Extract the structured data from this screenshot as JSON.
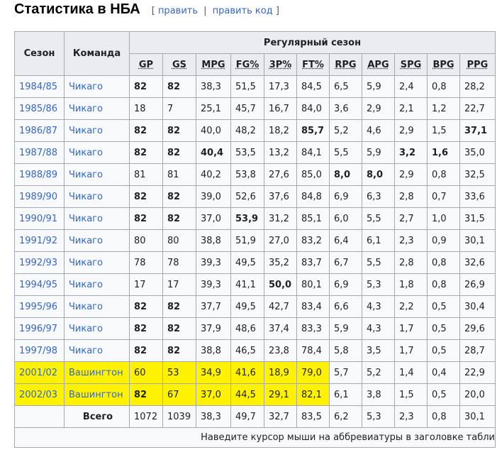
{
  "section": {
    "title": "Статистика в НБА",
    "edit_label": "править",
    "edit_code_label": "править код",
    "bracket_open": "[",
    "bracket_close": "]",
    "separator": "|"
  },
  "table": {
    "header_season": "Сезон",
    "header_team": "Команда",
    "header_group": "Регулярный сезон",
    "stat_headers": [
      "GP",
      "GS",
      "MPG",
      "FG%",
      "3P%",
      "FT%",
      "RPG",
      "APG",
      "SPG",
      "BPG",
      "PPG"
    ],
    "rows": [
      {
        "season": "1984/85",
        "team": "Чикаго",
        "stats": [
          "82",
          "82",
          "38,3",
          "51,5",
          "17,3",
          "84,5",
          "6,5",
          "5,9",
          "2,4",
          "0,8",
          "28,2"
        ],
        "bold": [
          0,
          1
        ],
        "highlight": false
      },
      {
        "season": "1985/86",
        "team": "Чикаго",
        "stats": [
          "18",
          "7",
          "25,1",
          "45,7",
          "16,7",
          "84,0",
          "3,6",
          "2,9",
          "2,1",
          "1,2",
          "22,7"
        ],
        "bold": [],
        "highlight": false
      },
      {
        "season": "1986/87",
        "team": "Чикаго",
        "stats": [
          "82",
          "82",
          "40,0",
          "48,2",
          "18,2",
          "85,7",
          "5,2",
          "4,6",
          "2,9",
          "1,5",
          "37,1"
        ],
        "bold": [
          0,
          1,
          5,
          10
        ],
        "highlight": false
      },
      {
        "season": "1987/88",
        "team": "Чикаго",
        "stats": [
          "82",
          "82",
          "40,4",
          "53,5",
          "13,2",
          "84,1",
          "5,5",
          "5,9",
          "3,2",
          "1,6",
          "35,0"
        ],
        "bold": [
          0,
          1,
          2,
          8,
          9
        ],
        "highlight": false
      },
      {
        "season": "1988/89",
        "team": "Чикаго",
        "stats": [
          "81",
          "81",
          "40,2",
          "53,8",
          "27,6",
          "85,0",
          "8,0",
          "8,0",
          "2,9",
          "0,8",
          "32,5"
        ],
        "bold": [
          6,
          7
        ],
        "highlight": false
      },
      {
        "season": "1989/90",
        "team": "Чикаго",
        "stats": [
          "82",
          "82",
          "39,0",
          "52,6",
          "37,6",
          "84,8",
          "6,9",
          "6,3",
          "2,8",
          "0,7",
          "33,6"
        ],
        "bold": [
          0,
          1
        ],
        "highlight": false
      },
      {
        "season": "1990/91",
        "team": "Чикаго",
        "stats": [
          "82",
          "82",
          "37,0",
          "53,9",
          "31,2",
          "85,1",
          "6,0",
          "5,5",
          "2,7",
          "1,0",
          "31,5"
        ],
        "bold": [
          0,
          1,
          3
        ],
        "highlight": false
      },
      {
        "season": "1991/92",
        "team": "Чикаго",
        "stats": [
          "80",
          "80",
          "38,8",
          "51,9",
          "27,0",
          "83,2",
          "6,4",
          "6,1",
          "2,3",
          "0,9",
          "30,1"
        ],
        "bold": [],
        "highlight": false
      },
      {
        "season": "1992/93",
        "team": "Чикаго",
        "stats": [
          "78",
          "78",
          "39,3",
          "49,5",
          "35,2",
          "83,7",
          "6,7",
          "5,5",
          "2,8",
          "0,8",
          "32,6"
        ],
        "bold": [],
        "highlight": false
      },
      {
        "season": "1994/95",
        "team": "Чикаго",
        "stats": [
          "17",
          "17",
          "39,3",
          "41,1",
          "50,0",
          "80,1",
          "6,9",
          "5,3",
          "1,8",
          "0,8",
          "26,9"
        ],
        "bold": [
          4
        ],
        "highlight": false
      },
      {
        "season": "1995/96",
        "team": "Чикаго",
        "stats": [
          "82",
          "82",
          "37,7",
          "49,5",
          "42,7",
          "83,4",
          "6,6",
          "4,3",
          "2,2",
          "0,5",
          "30,4"
        ],
        "bold": [
          0,
          1
        ],
        "highlight": false
      },
      {
        "season": "1996/97",
        "team": "Чикаго",
        "stats": [
          "82",
          "82",
          "37,9",
          "48,6",
          "37,4",
          "83,3",
          "5,9",
          "4,3",
          "1,7",
          "0,5",
          "29,6"
        ],
        "bold": [
          0,
          1
        ],
        "highlight": false
      },
      {
        "season": "1997/98",
        "team": "Чикаго",
        "stats": [
          "82",
          "82",
          "38,8",
          "46,5",
          "23,8",
          "78,4",
          "5,8",
          "3,5",
          "1,7",
          "0,5",
          "28,7"
        ],
        "bold": [
          0,
          1
        ],
        "highlight": false
      },
      {
        "season": "2001/02",
        "team": "Вашингтон",
        "stats": [
          "60",
          "53",
          "34,9",
          "41,6",
          "18,9",
          "79,0",
          "5,7",
          "5,2",
          "1,4",
          "0,4",
          "22,9"
        ],
        "bold": [],
        "highlight": true
      },
      {
        "season": "2002/03",
        "team": "Вашингтон",
        "stats": [
          "82",
          "67",
          "37,0",
          "44,5",
          "29,1",
          "82,1",
          "6,1",
          "3,8",
          "1,5",
          "0,5",
          "20,0"
        ],
        "bold": [
          0
        ],
        "highlight": true
      }
    ],
    "total_label": "Всего",
    "total_stats": [
      "1072",
      "1039",
      "38,3",
      "49,7",
      "32,7",
      "83,5",
      "6,2",
      "5,3",
      "2,3",
      "0,8",
      "30,1"
    ],
    "footnote": "Наведите курсор мыши на аббревиатуры в заголовке табли"
  },
  "colors": {
    "link": "#3366cc",
    "highlight": "#fff200",
    "header_bg": "#eaecf0",
    "cell_bg": "#f8f9fa",
    "border": "#a2a9b1"
  }
}
